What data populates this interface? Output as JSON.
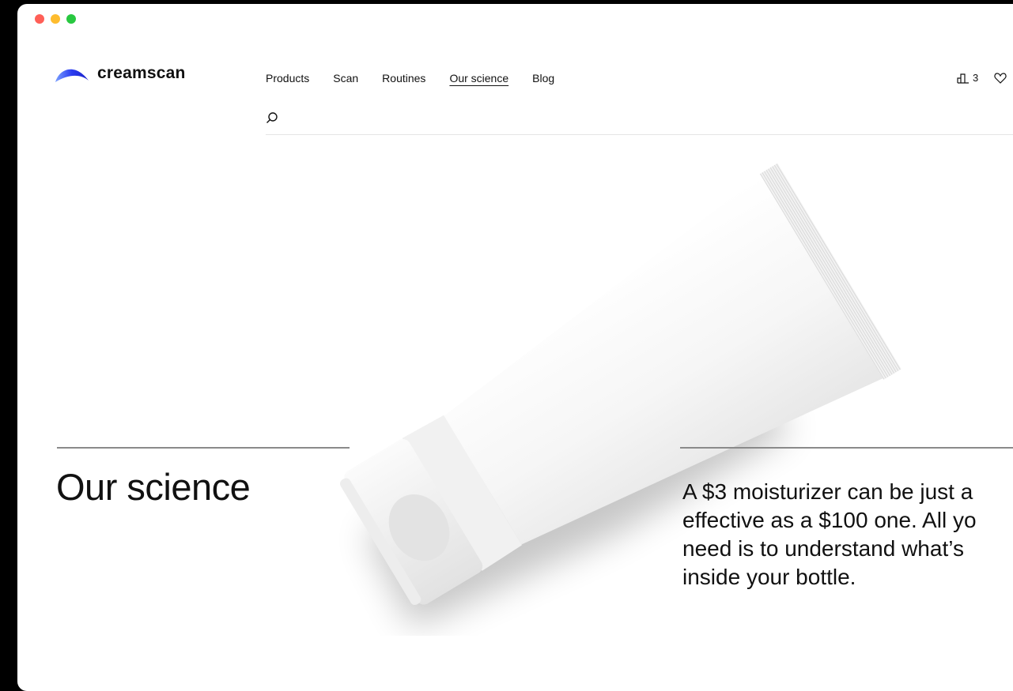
{
  "brand": {
    "name": "creamscan",
    "accent": "#2b3cf0"
  },
  "window": {
    "controls": [
      "close",
      "minimize",
      "maximize"
    ]
  },
  "nav": {
    "items": [
      {
        "label": "Products"
      },
      {
        "label": "Scan"
      },
      {
        "label": "Routines"
      },
      {
        "label": "Our science",
        "active": true
      },
      {
        "label": "Blog"
      }
    ]
  },
  "tools": {
    "compare": {
      "icon": "compare-icon",
      "count": "3"
    },
    "favorites": {
      "icon": "heart-icon"
    }
  },
  "search": {
    "icon": "search-icon"
  },
  "hero": {
    "title": "Our science",
    "body": "A $3 moisturizer can be just a\neffective as a $100 one. All yo\nneed is to understand what’s\ninside your bottle.",
    "image": "white cream tube"
  }
}
